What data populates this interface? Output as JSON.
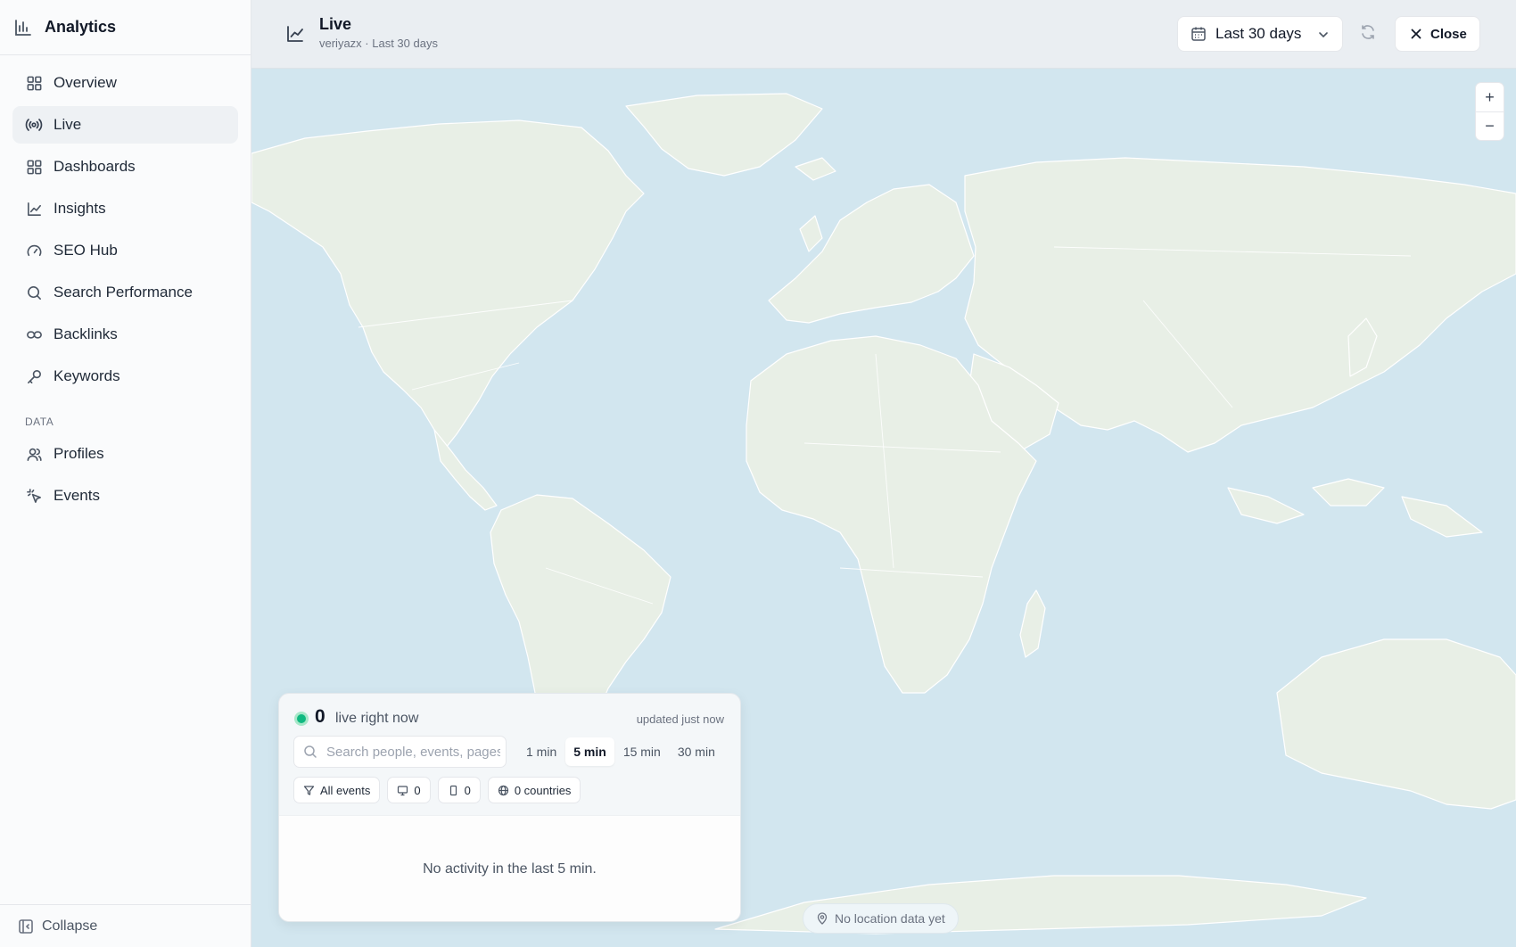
{
  "brand": {
    "title": "Analytics",
    "icon": "bar-chart-icon"
  },
  "sidebar": {
    "items": [
      {
        "label": "Overview",
        "icon": "grid-icon",
        "active": false
      },
      {
        "label": "Live",
        "icon": "broadcast-icon",
        "active": true
      },
      {
        "label": "Dashboards",
        "icon": "grid-icon",
        "active": false
      },
      {
        "label": "Insights",
        "icon": "line-chart-icon",
        "active": false
      },
      {
        "label": "SEO Hub",
        "icon": "gauge-icon",
        "active": false
      },
      {
        "label": "Search Performance",
        "icon": "search-icon",
        "active": false
      },
      {
        "label": "Backlinks",
        "icon": "link-icon",
        "active": false
      },
      {
        "label": "Keywords",
        "icon": "key-icon",
        "active": false
      }
    ],
    "section_label": "DATA",
    "data_items": [
      {
        "label": "Profiles",
        "icon": "users-icon"
      },
      {
        "label": "Events",
        "icon": "cursor-click-icon"
      }
    ],
    "collapse_label": "Collapse"
  },
  "header": {
    "title": "Live",
    "subtitle": "veriyazx · Last 30 days",
    "date_range": "Last 30 days",
    "close_label": "Close"
  },
  "map": {
    "zoom_in": "+",
    "zoom_out": "−",
    "no_location": "No location data yet",
    "colors": {
      "ocean": "#d2e6ef",
      "land": "#e8efe6"
    }
  },
  "live_panel": {
    "count": "0",
    "label": "live right now",
    "updated": "updated just now",
    "search_placeholder": "Search people, events, pages",
    "ranges": [
      "1 min",
      "5 min",
      "15 min",
      "30 min"
    ],
    "active_range": "5 min",
    "chips": {
      "all_events": "All events",
      "desktop": "0",
      "mobile": "0",
      "countries": "0 countries"
    },
    "empty": "No activity in the last 5 min.",
    "status_color": "#10b981"
  }
}
